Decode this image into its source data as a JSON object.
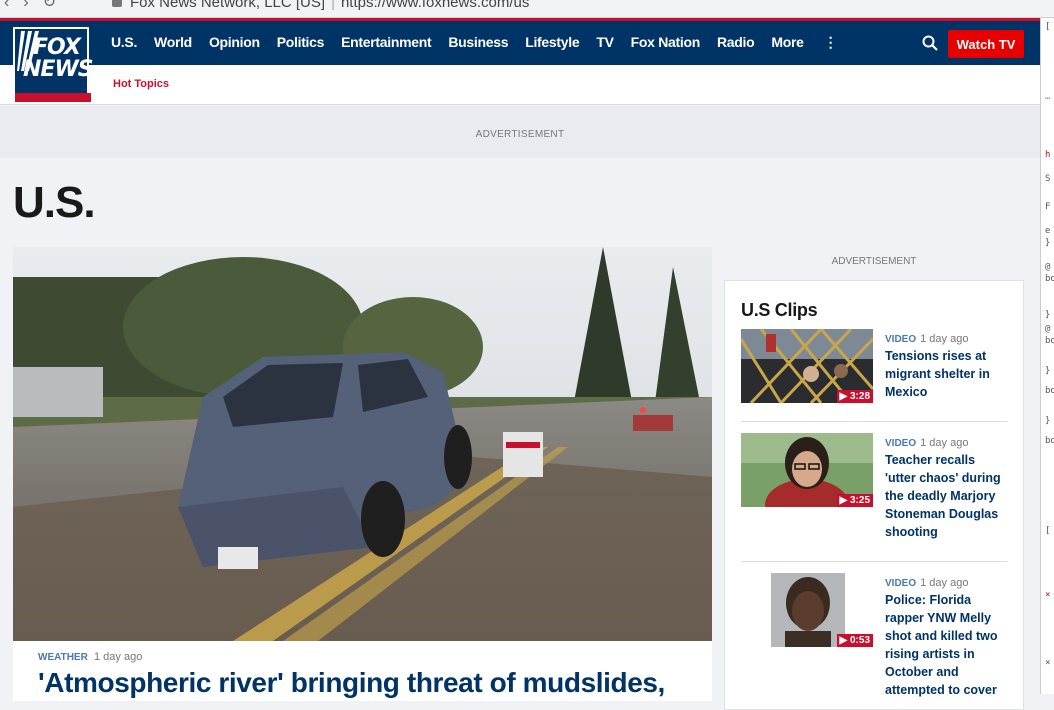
{
  "browser": {
    "url_text": "Fox News Network, LLC [US]",
    "url": "https://www.foxnews.com/us"
  },
  "logo": {
    "line1": "FOX",
    "line2": "NEWS"
  },
  "nav": {
    "items": [
      "U.S.",
      "World",
      "Opinion",
      "Politics",
      "Entertainment",
      "Business",
      "Lifestyle",
      "TV",
      "Fox Nation",
      "Radio",
      "More"
    ],
    "watch_label": "Watch TV",
    "hot_topics": "Hot Topics"
  },
  "ads": {
    "top_label": "ADVERTISEMENT",
    "side_label": "ADVERTISEMENT"
  },
  "page": {
    "title": "U.S."
  },
  "hero": {
    "kicker": "WEATHER",
    "time": "1 day ago",
    "headline": "'Atmospheric river' bringing threat of mudslides,"
  },
  "clips": {
    "title": "U.S Clips",
    "items": [
      {
        "kicker": "VIDEO",
        "time": "1 day ago",
        "headline": "Tensions rises at migrant shelter in Mexico",
        "duration": "3:28"
      },
      {
        "kicker": "VIDEO",
        "time": "1 day ago",
        "headline": "Teacher recalls 'utter chaos' during the deadly Marjory Stoneman Douglas shooting",
        "duration": "3:25"
      },
      {
        "kicker": "VIDEO",
        "time": "1 day ago",
        "headline": "Police: Florida rapper YNW Melly shot and killed two rising artists in October and attempted to cover",
        "duration": "0:53"
      }
    ]
  },
  "colors": {
    "brand_navy": "#003366",
    "brand_red": "#c8102e",
    "watch_red": "#e60000",
    "link_blue": "#4a78b6"
  },
  "devtools": {
    "snippets": [
      "h",
      "S",
      "F",
      "e",
      "}",
      "@",
      "bo",
      "}",
      "@",
      "bo",
      "}",
      "bo",
      "}",
      "bo",
      "[",
      "×",
      "×"
    ]
  }
}
